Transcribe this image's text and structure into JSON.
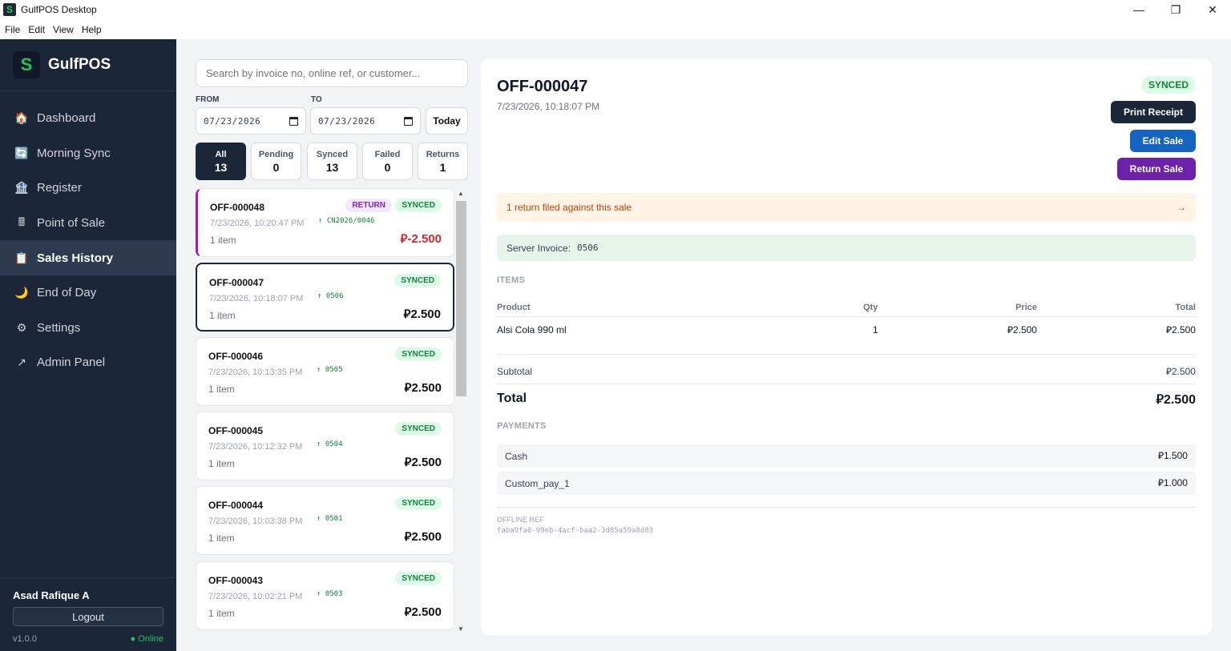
{
  "window": {
    "title": "GulfPOS Desktop",
    "controls": {
      "minimize": "—",
      "maximize": "❐",
      "close": "✕"
    }
  },
  "menu": [
    "File",
    "Edit",
    "View",
    "Help"
  ],
  "sidebar": {
    "brand": "GulfPOS",
    "brand_logo": "S",
    "items": [
      {
        "label": "Dashboard",
        "icon": "house-icon",
        "glyph": "🏠",
        "active": false
      },
      {
        "label": "Morning Sync",
        "icon": "sync-icon",
        "glyph": "🔄",
        "active": false
      },
      {
        "label": "Register",
        "icon": "register-icon",
        "glyph": "🏦",
        "active": false
      },
      {
        "label": "Point of Sale",
        "icon": "pos-icon",
        "glyph": "🖩",
        "active": false
      },
      {
        "label": "Sales History",
        "icon": "clipboard-icon",
        "glyph": "📋",
        "active": true
      },
      {
        "label": "End of Day",
        "icon": "moon-icon",
        "glyph": "🌙",
        "active": false
      },
      {
        "label": "Settings",
        "icon": "gear-icon",
        "glyph": "⚙",
        "active": false
      },
      {
        "label": "Admin Panel",
        "icon": "arrow-icon",
        "glyph": "↗",
        "active": false
      }
    ],
    "user_name": "Asad Rafique A",
    "logout_label": "Logout",
    "version": "v1.0.0",
    "status": "● Online"
  },
  "filters": {
    "search_placeholder": "Search by invoice no, online ref, or customer...",
    "from_label": "FROM",
    "to_label": "TO",
    "from_date": "07/23/2026",
    "to_date": "07/23/2026",
    "today_label": "Today",
    "tabs": [
      {
        "label": "All",
        "count": "13"
      },
      {
        "label": "Pending",
        "count": "0"
      },
      {
        "label": "Synced",
        "count": "13"
      },
      {
        "label": "Failed",
        "count": "0"
      },
      {
        "label": "Returns",
        "count": "1"
      }
    ]
  },
  "sales": [
    {
      "invoice": "OFF-000048",
      "datetime": "7/23/2026, 10:20:47 PM",
      "ref": "↑ CN2026/0046",
      "items": "1 item",
      "amount": "⃁-2.500",
      "badge": "SYNCED",
      "return_badge": "RETURN"
    },
    {
      "invoice": "OFF-000047",
      "datetime": "7/23/2026, 10:18:07 PM",
      "ref": "↑ 0506",
      "items": "1 item",
      "amount": "⃁2.500",
      "badge": "SYNCED"
    },
    {
      "invoice": "OFF-000046",
      "datetime": "7/23/2026, 10:13:35 PM",
      "ref": "↑ 0505",
      "items": "1 item",
      "amount": "⃁2.500",
      "badge": "SYNCED"
    },
    {
      "invoice": "OFF-000045",
      "datetime": "7/23/2026, 10:12:32 PM",
      "ref": "↑ 0504",
      "items": "1 item",
      "amount": "⃁2.500",
      "badge": "SYNCED"
    },
    {
      "invoice": "OFF-000044",
      "datetime": "7/23/2026, 10:03:38 PM",
      "ref": "↑ 0501",
      "items": "1 item",
      "amount": "⃁2.500",
      "badge": "SYNCED"
    },
    {
      "invoice": "OFF-000043",
      "datetime": "7/23/2026, 10:02:21 PM",
      "ref": "↑ 0503",
      "items": "1 item",
      "amount": "⃁2.500",
      "badge": "SYNCED"
    }
  ],
  "detail": {
    "invoice": "OFF-000047",
    "datetime": "7/23/2026, 10:18:07 PM",
    "status": "SYNCED",
    "print_label": "Print Receipt",
    "edit_label": "Edit Sale",
    "return_label": "Return Sale",
    "alert_text": "1 return filed against this sale",
    "alert_arrow": "→",
    "server_label": "Server Invoice:",
    "server_value": "0506",
    "items_heading": "ITEMS",
    "columns": {
      "product": "Product",
      "qty": "Qty",
      "price": "Price",
      "total": "Total"
    },
    "line_items": [
      {
        "product": "Alsi Cola 990 ml",
        "qty": "1",
        "price": "⃁2.500",
        "total": "⃁2.500"
      }
    ],
    "subtotal_label": "Subtotal",
    "subtotal_value": "⃁2.500",
    "total_label": "Total",
    "total_value": "⃁2.500",
    "payments_heading": "PAYMENTS",
    "payments": [
      {
        "method": "Cash",
        "amount": "⃁1.500"
      },
      {
        "method": "Custom_pay_1",
        "amount": "⃁1.000"
      }
    ],
    "offline_label": "OFFLINE REF",
    "offline_value": "faba9fa0-99eb-4acf-baa2-3d85a59a8d03"
  }
}
